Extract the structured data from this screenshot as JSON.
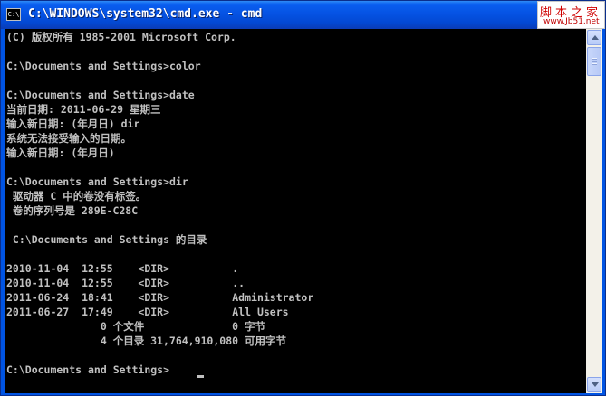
{
  "window": {
    "title": "C:\\WINDOWS\\system32\\cmd.exe - cmd",
    "icon_text": "C:\\"
  },
  "watermark": {
    "main": "脚本之家",
    "url": "www.Jb51.net"
  },
  "console": {
    "lines": [
      "(C) 版权所有 1985-2001 Microsoft Corp.",
      "",
      "C:\\Documents and Settings>color",
      "",
      "C:\\Documents and Settings>date",
      "当前日期: 2011-06-29 星期三",
      "输入新日期: (年月日) dir",
      "系统无法接受输入的日期。",
      "输入新日期: (年月日)",
      "",
      "C:\\Documents and Settings>dir",
      " 驱动器 C 中的卷没有标签。",
      " 卷的序列号是 289E-C28C",
      "",
      " C:\\Documents and Settings 的目录",
      "",
      "2010-11-04  12:55    <DIR>          .",
      "2010-11-04  12:55    <DIR>          ..",
      "2011-06-24  18:41    <DIR>          Administrator",
      "2011-06-27  17:49    <DIR>          All Users",
      "               0 个文件              0 字节",
      "               4 个目录 31,764,910,080 可用字节",
      "",
      "C:\\Documents and Settings>"
    ]
  },
  "scrollbar": {
    "up_icon": "scroll-up-arrow",
    "down_icon": "scroll-down-arrow"
  },
  "colors": {
    "titlebar": "#0552e2",
    "console_bg": "#000000",
    "console_fg": "#c0c0c0",
    "watermark_red": "#d00000"
  }
}
